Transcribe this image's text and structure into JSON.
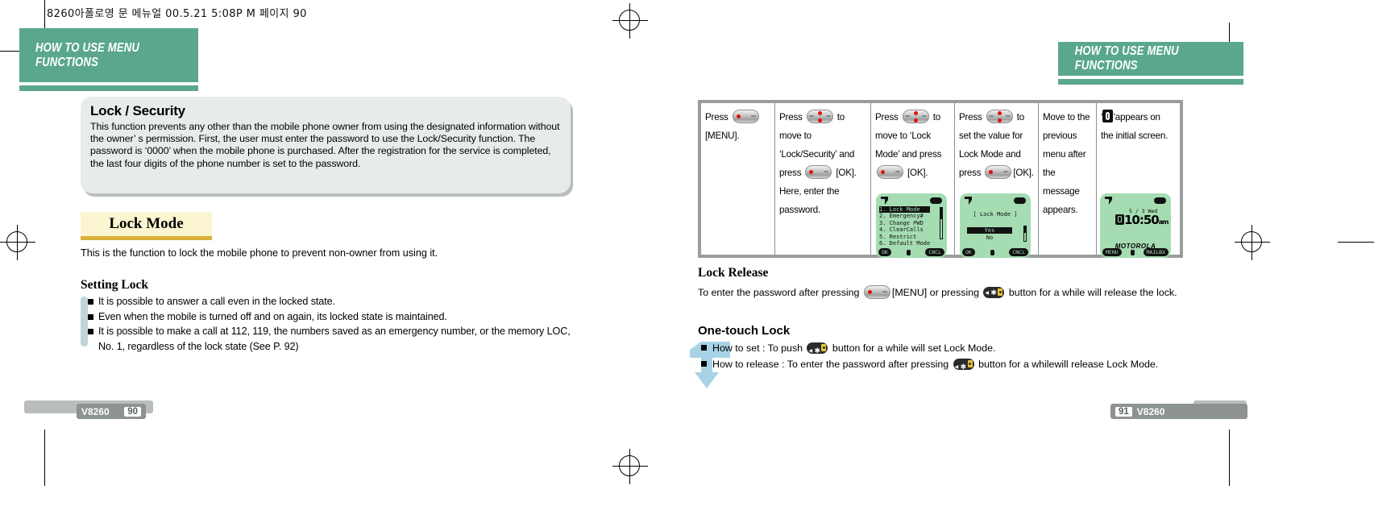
{
  "slug": "8260아폴로영 문 메뉴얼   00.5.21 5:08P M 페이지 90",
  "chapter_tab": "HOW TO USE MENU FUNCTIONS",
  "colors": {
    "chapter_green": "#5aa78c",
    "info_box": "#e7ecea",
    "mode_tab": "#fcf5d2",
    "mode_tab_underline": "#d9b13a",
    "bullet_bar": "#bfd5d6",
    "lcd_green": "#a5dcb2",
    "arrow_blue": "#a8d3e6",
    "footer_gray": "#8d9292"
  },
  "left_page": {
    "info": {
      "title": "Lock / Security",
      "body": "This function prevents any other than the mobile phone owner from using the designated information without the owner’ s permission. First, the user must enter the password to use the Lock/Security function. The password  is  ‘0000’  when the mobile phone is purchased. After the registration for the service is completed, the last four digits of the phone number is set to the password."
    },
    "mode_tab": "Lock Mode",
    "description": "This is the function to lock the mobile phone to prevent non-owner from using it.",
    "setting_lock_heading": "Setting Lock",
    "setting_lock_bullets": [
      "It is possible to answer a call even in the locked state.",
      "Even when the mobile is turned off and on again, its locked state is maintained.",
      "It is possible to make a call at 112, 119, the numbers saved as an emergency number, or the memory LOC, No. 1, regardless of the lock state (See P. 92)"
    ],
    "footer": {
      "model": "V8260",
      "page": "90"
    }
  },
  "right_page": {
    "steps": [
      {
        "text_parts": [
          "Press ",
          " [MENU]."
        ],
        "keys": [
          "ok"
        ]
      },
      {
        "text_parts": [
          "Press ",
          " to move to ‘Lock/Security’ and press ",
          " [OK]. Here, enter the password."
        ],
        "keys": [
          "ud",
          "ok"
        ]
      },
      {
        "text_parts": [
          "Press ",
          " to move to ‘Lock Mode’ and press ",
          " [OK]."
        ],
        "keys": [
          "ud",
          "ok"
        ]
      },
      {
        "text_parts": [
          "Press ",
          " to set the value for Lock Mode and press ",
          "[OK]."
        ],
        "keys": [
          "ud",
          "ok"
        ]
      },
      {
        "text_parts": [
          "Move to the previous menu after the message appears."
        ],
        "keys": []
      },
      {
        "text_parts": [
          "‘",
          "’appears on the initial screen."
        ],
        "keys": []
      }
    ],
    "lcd_menu": {
      "items": [
        "1. Lock Mode",
        "2. Emergency#",
        "3. Change PWD",
        "4. ClearCalls",
        "5. Restrict",
        "6. Default Mode"
      ],
      "selected_index": 0,
      "soft_left": "OK",
      "soft_right": "CNCL"
    },
    "lcd_confirm": {
      "title": "[ Lock Mode ]",
      "options": [
        "Yes",
        "No"
      ],
      "selected": "Yes",
      "soft_left": "OK",
      "soft_right": "CNCL"
    },
    "lcd_idle": {
      "date": "5 / 3  Wed",
      "time": "10:50",
      "meridiem": "am",
      "brand": "MOTOROLA",
      "soft_left": "MENU",
      "soft_right": "MAILBX"
    },
    "lock_release": {
      "heading": "Lock Release",
      "text_a": "To enter the password after pressing ",
      "text_b": "[MENU] or pressing ",
      "text_c": " button for a while will release the lock."
    },
    "one_touch": {
      "heading": "One-touch Lock",
      "set_a": "How to set : To push ",
      "set_b": " button for a while will set Lock Mode.",
      "rel_a": "How to  release : To enter  the password after  pressing ",
      "rel_b": " button for a  while",
      "rel_c": "will  release Lock Mode."
    },
    "footer": {
      "model": "V8260",
      "page": "91"
    }
  }
}
